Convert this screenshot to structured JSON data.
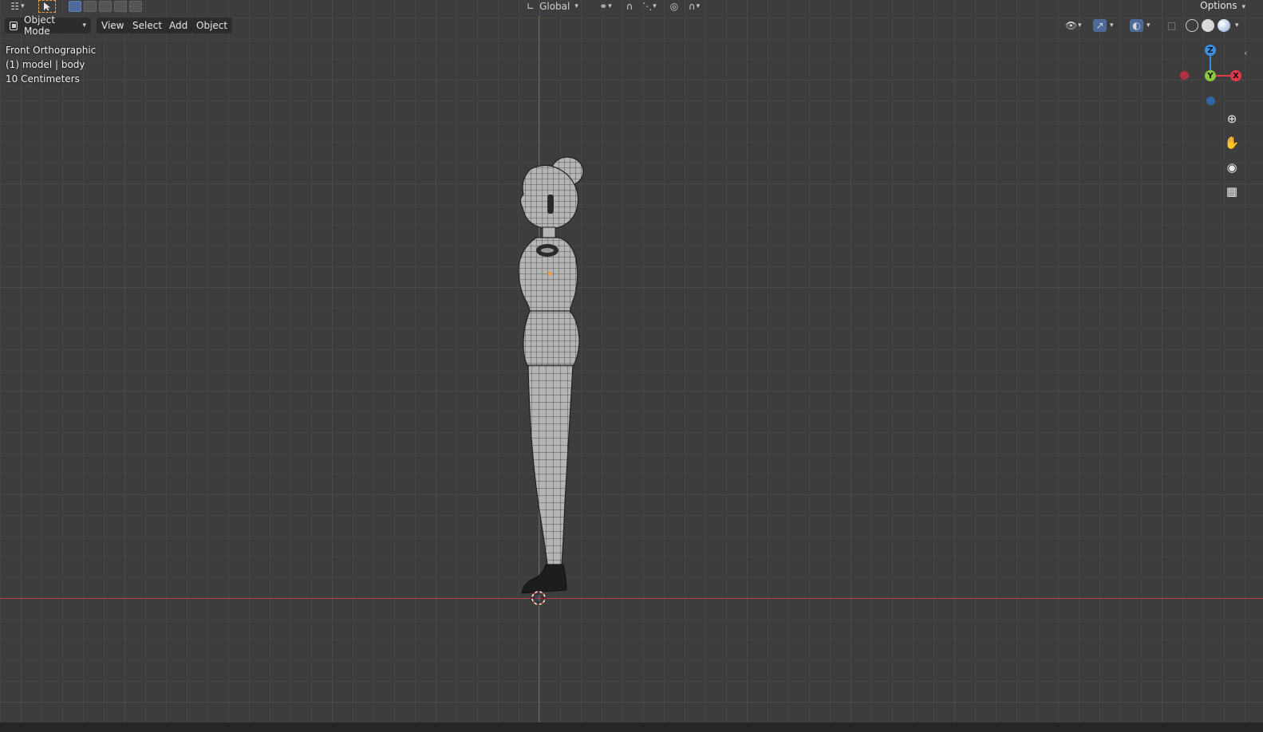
{
  "header_top": {
    "transform_orientation": "Global",
    "options_label": "Options"
  },
  "header": {
    "mode_label": "Object Mode",
    "menus": [
      "View",
      "Select",
      "Add",
      "Object"
    ]
  },
  "overlay_info": {
    "view_name": "Front Orthographic",
    "object_info": "(1) model | body",
    "grid_scale": "10 Centimeters"
  },
  "gizmo": {
    "z_label": "Z",
    "y_label": "Y",
    "x_label": "X",
    "colors": {
      "x": "#e6394b",
      "y": "#8cc63f",
      "z": "#3b8fe0"
    }
  },
  "icons": {
    "editor_type": "viewport-editor-icon",
    "tool": "select-cursor-icon",
    "zoom": "zoom-in-icon",
    "pan": "hand-icon",
    "camera": "camera-icon",
    "ortho": "grid-icon"
  },
  "colors": {
    "viewport_bg": "#3d3d3d",
    "x_axis": "#b8424d",
    "z_axis": "#3d6fb0",
    "selection_accent": "#f0a040"
  }
}
